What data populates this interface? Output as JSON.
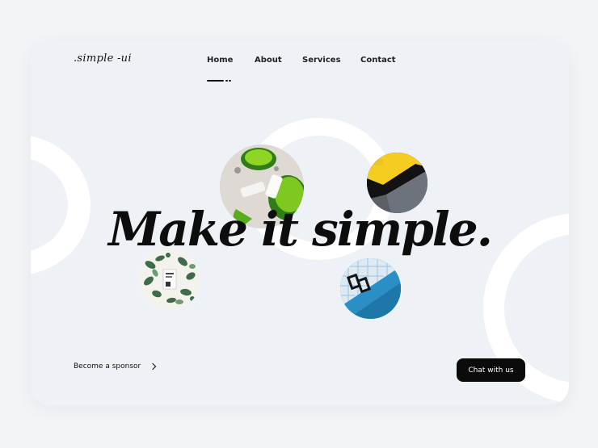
{
  "brand": {
    "logo_text": ".simple -ui"
  },
  "nav": {
    "items": [
      {
        "label": "Home",
        "active": true
      },
      {
        "label": "About"
      },
      {
        "label": "Services"
      },
      {
        "label": "Contact"
      }
    ]
  },
  "hero": {
    "headline": "Make it simple."
  },
  "footer": {
    "sponsor_label": "Become a sponsor",
    "chat_label": "Chat with us"
  },
  "images": [
    {
      "name": "green-cups-photo"
    },
    {
      "name": "yellow-gray-abstract-photo"
    },
    {
      "name": "leaf-pattern-card-photo"
    },
    {
      "name": "blue-grid-object-photo"
    }
  ],
  "colors": {
    "page_bg": "#f3f4f7",
    "card_bg": "#eef1f6",
    "ring": "#ffffff",
    "text": "#111111",
    "button_bg": "#0b0b0b",
    "button_text": "#ffffff"
  }
}
